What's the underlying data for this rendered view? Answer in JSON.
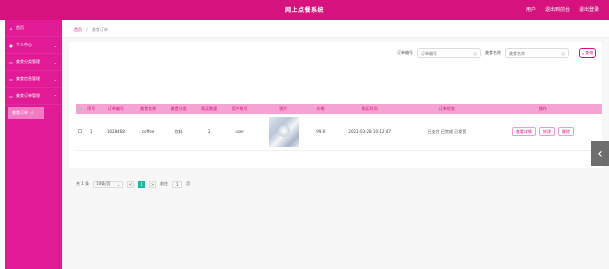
{
  "header": {
    "title": "网上点餐系统",
    "links": [
      "用户",
      "退出到前台",
      "退出登录"
    ]
  },
  "sidebar": {
    "items": [
      {
        "label": "首页",
        "icon": "home-icon"
      },
      {
        "label": "个人中心",
        "icon": "user-icon"
      },
      {
        "label": "美食分类管理",
        "icon": "folder-icon"
      },
      {
        "label": "美食信息管理",
        "icon": "folder-icon"
      },
      {
        "label": "美食订单管理",
        "icon": "folder-icon"
      }
    ],
    "sub_item": "美食订单"
  },
  "breadcrumb": {
    "home": "首页",
    "sep": "/",
    "current": "美食订单"
  },
  "search": {
    "label1": "订单编号",
    "placeholder1": "订单编号",
    "label2": "美食名称",
    "placeholder2": "美食名称",
    "button": "查询"
  },
  "table": {
    "headers": [
      "",
      "序号",
      "订单编号",
      "美食名称",
      "美食分类",
      "购买数量",
      "用户账号",
      "图片",
      "价格",
      "购买时间",
      "订单状态",
      "操作"
    ],
    "rows": [
      {
        "index": "1",
        "order_no": "3028468",
        "food_name": "coffee",
        "category": "饮料",
        "quantity": "2",
        "user": "user",
        "price": "99.8",
        "time": "2021-03-28 10:12:47",
        "status": "已支付 已完成 已发货",
        "ops": [
          "查看详情",
          "修改",
          "删除"
        ]
      }
    ]
  },
  "pager": {
    "total": "共 1 条",
    "per_page": "10条/页",
    "prev": "<",
    "page": "1",
    "next": ">",
    "goto": "前往",
    "goto_value": "1",
    "page_suffix": "页"
  },
  "colors": {
    "brand": "#d6127f",
    "sidebar": "#e21a95",
    "active_page": "#1eb69d"
  }
}
